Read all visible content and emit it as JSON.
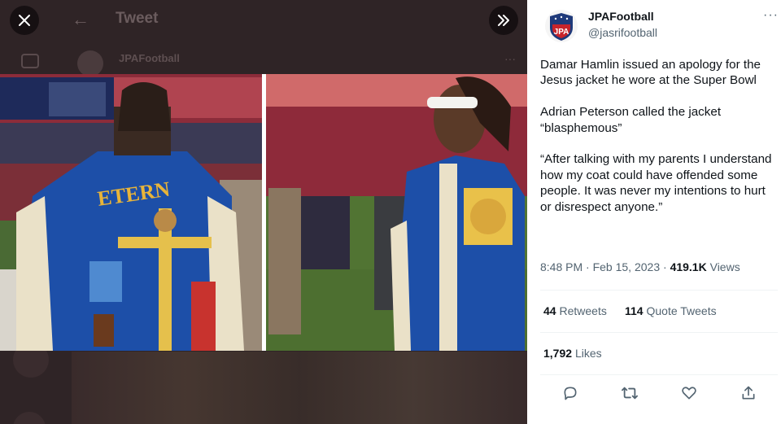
{
  "background": {
    "header_title": "Tweet",
    "account_name": "JPAFootball"
  },
  "overlay": {
    "close_icon": "close-icon",
    "expand_icon": "chevron-double-right-icon"
  },
  "media": {
    "left_jacket_letters": "ETERN"
  },
  "tweet": {
    "author_name": "JPAFootball",
    "author_handle": "@jasrifootball",
    "avatar_text": "JPA",
    "more_label": "···",
    "paragraphs": [
      "Damar Hamlin issued an apology for the Jesus jacket he wore at the Super Bowl",
      "Adrian Peterson called the jacket “blasphemous”",
      "“After talking with my parents I understand how my coat could have offended some people. It was never my intentions to hurt or disrespect anyone.”"
    ],
    "time": "8:48 PM",
    "separator": "·",
    "date": "Feb 15, 2023",
    "views_count": "419.1K",
    "views_label": "Views",
    "retweets_count": "44",
    "retweets_label": "Retweets",
    "quotes_count": "114",
    "quotes_label": "Quote Tweets",
    "likes_count": "1,792",
    "likes_label": "Likes"
  },
  "colors": {
    "text_primary": "#0f1419",
    "text_secondary": "#536471",
    "divider": "#eff3f4",
    "jacket_blue": "#1d4fa8"
  }
}
